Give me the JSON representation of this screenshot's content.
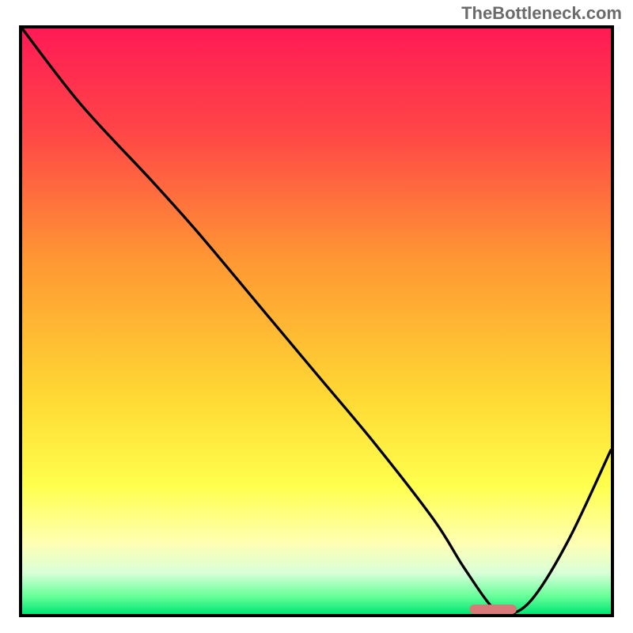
{
  "watermark": "TheBottleneck.com",
  "chart_data": {
    "type": "line",
    "title": "",
    "xlabel": "",
    "ylabel": "",
    "xlim": [
      0,
      100
    ],
    "ylim": [
      0,
      100
    ],
    "background_gradient_stops": [
      {
        "offset": 0,
        "color": "#ff1a55"
      },
      {
        "offset": 18,
        "color": "#ff4747"
      },
      {
        "offset": 40,
        "color": "#ff9933"
      },
      {
        "offset": 62,
        "color": "#ffd633"
      },
      {
        "offset": 78,
        "color": "#ffff4d"
      },
      {
        "offset": 88,
        "color": "#ffffb3"
      },
      {
        "offset": 93,
        "color": "#d9ffd9"
      },
      {
        "offset": 97,
        "color": "#66ff99"
      },
      {
        "offset": 100,
        "color": "#00e673"
      }
    ],
    "series": [
      {
        "name": "bottleneck-curve",
        "color": "#000000",
        "x": [
          0,
          10,
          22,
          30,
          40,
          50,
          60,
          70,
          75,
          80,
          83,
          87,
          93,
          100
        ],
        "y": [
          100,
          87,
          74,
          65,
          53,
          41,
          29,
          16,
          8,
          1,
          0,
          3,
          13,
          28
        ]
      }
    ],
    "marker": {
      "name": "optimal-range-marker",
      "color": "#d87a7a",
      "x_center": 80,
      "y": 0,
      "width_pct": 8,
      "height_pct": 1.6,
      "radius_pct": 0.8
    }
  }
}
